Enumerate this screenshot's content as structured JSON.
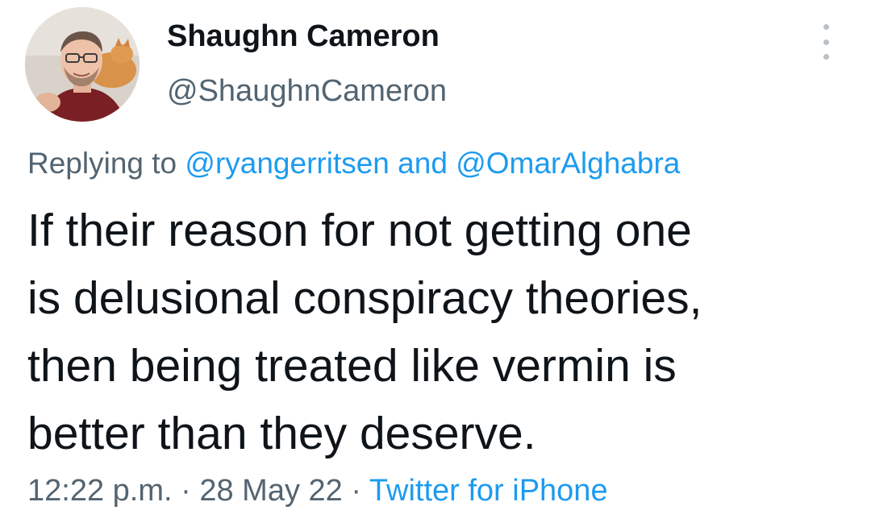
{
  "user": {
    "display_name": "Shaughn Cameron",
    "handle": "@ShaughnCameron"
  },
  "reply": {
    "prefix": "Replying to",
    "mention_1": "@ryangerritsen",
    "conjunction": "and",
    "mention_2": "@OmarAlghabra"
  },
  "tweet": {
    "lines": [
      "If their reason for not getting one",
      "is delusional conspiracy theories,",
      "then being treated like vermin is",
      "better than they deserve."
    ]
  },
  "meta": {
    "time": "12:22 p.m.",
    "separator": "·",
    "date": "28 May 22",
    "source": "Twitter for iPhone"
  },
  "icons": {
    "more": "more-vertical-icon",
    "avatar": "avatar-photo"
  },
  "colors": {
    "text": "#0f1419",
    "secondary": "#536471",
    "link": "#1d9bf0"
  }
}
